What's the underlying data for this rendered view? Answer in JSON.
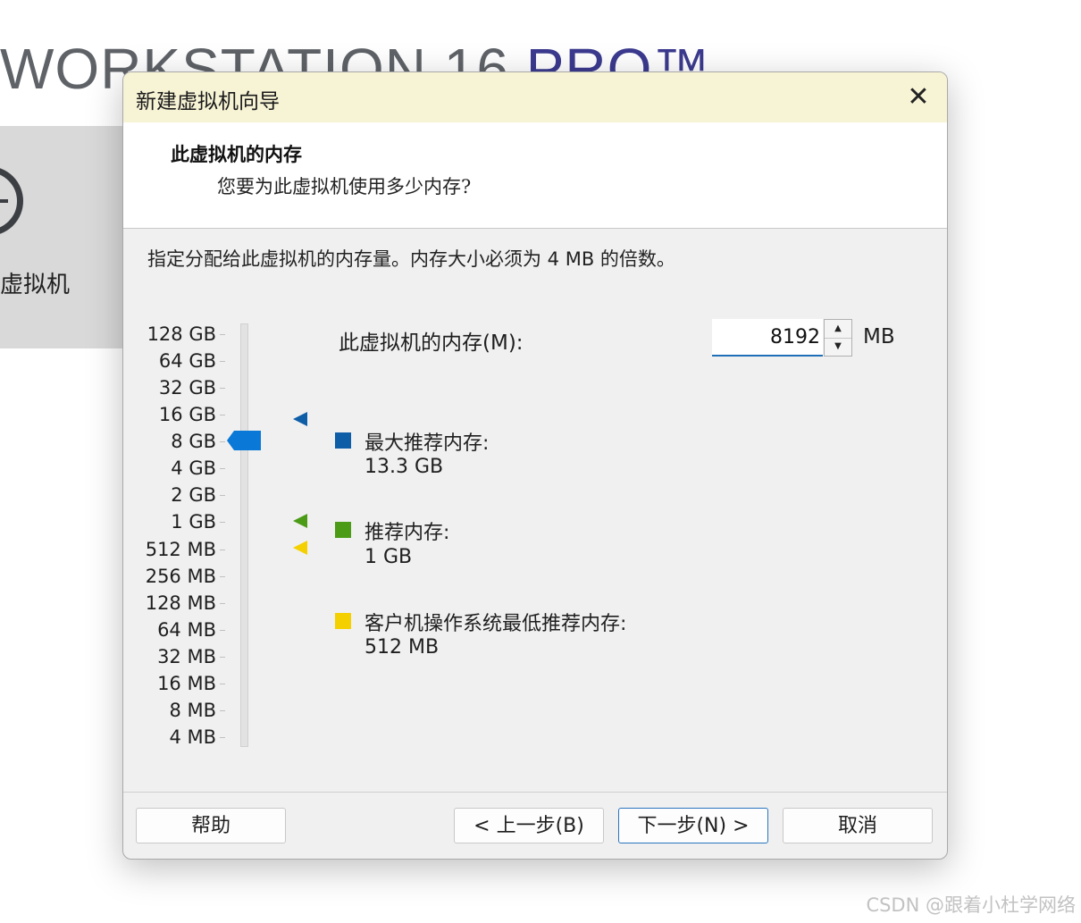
{
  "background": {
    "app_title_main": "WORKSTATION 16",
    "app_title_suffix": "PRO™",
    "left_panel_label": "虚拟机"
  },
  "dialog": {
    "title": "新建虚拟机向导",
    "close_icon": "close-icon",
    "header": {
      "title": "此虚拟机的内存",
      "subtitle": "您要为此虚拟机使用多少内存?"
    },
    "description": "指定分配给此虚拟机的内存量。内存大小必须为 4 MB 的倍数。",
    "memory": {
      "label": "此虚拟机的内存(M):",
      "value": "8192",
      "unit": "MB",
      "selected_scale": "8 GB"
    },
    "scale": [
      "128 GB",
      "64 GB",
      "32 GB",
      "16 GB",
      "8 GB",
      "4 GB",
      "2 GB",
      "1 GB",
      "512 MB",
      "256 MB",
      "128 MB",
      "64 MB",
      "32 MB",
      "16 MB",
      "8 MB",
      "4 MB"
    ],
    "legend": {
      "max": {
        "title": "最大推荐内存:",
        "value": "13.3 GB",
        "color": "#0e5da7"
      },
      "recommended": {
        "title": "推荐内存:",
        "value": "1 GB",
        "color": "#4b9b17"
      },
      "guest_min": {
        "title": "客户机操作系统最低推荐内存:",
        "value": "512 MB",
        "color": "#f5d000"
      }
    },
    "buttons": {
      "help": "帮助",
      "back": "< 上一步(B)",
      "next": "下一步(N) >",
      "cancel": "取消"
    },
    "slider_color": "#0a78d7"
  },
  "watermark": "CSDN @跟着小杜学网络"
}
